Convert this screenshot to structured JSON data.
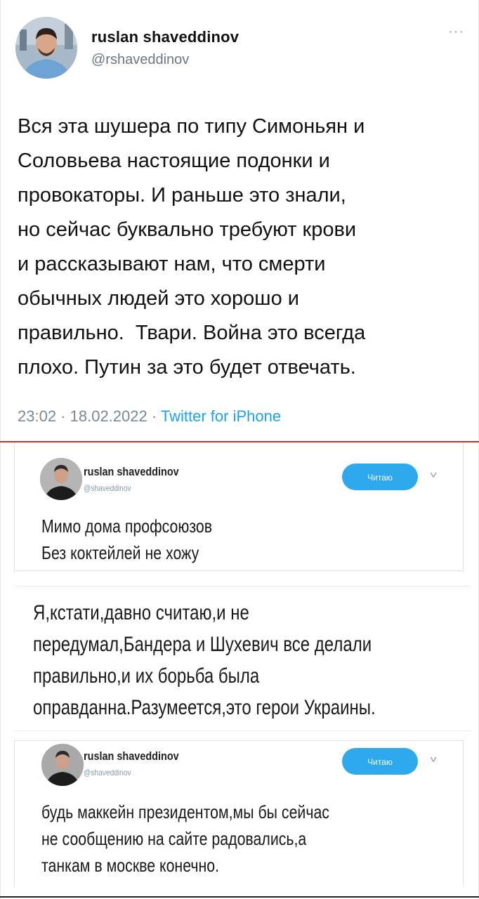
{
  "main_tweet": {
    "name": "ruslan shaveddinov",
    "handle": "@rshaveddinov",
    "more": "···",
    "text_lines": [
      "Вся эта шушера по типу Симоньян и",
      "Соловьева настоящие подонки и",
      "провокаторы. И раньше это знали,",
      "но сейчас буквально требуют крови",
      "и рассказывают нам, что смерти",
      "обычных людей это хорошо и",
      "правильно.  Твари. Война это всегда",
      "плохо. Путин за это будет отвечать."
    ],
    "time": "23:02",
    "date": "18.02.2022",
    "source": "Twitter for iPhone",
    "separator": " · "
  },
  "screenshot_1": {
    "name": "ruslan shaveddinov",
    "handle": "@shaveddinov",
    "follow_label": "Читаю",
    "chevron": "˅",
    "text_lines": [
      "Мимо дома профсоюзов",
      "Без коктейлей не хожу"
    ]
  },
  "screenshot_2": {
    "text_lines": [
      "Я,кстати,давно считаю,и не",
      "передумал,Бандера и Шухевич все делали",
      "правильно,и их борьба была",
      "оправданна.Разумеется,это герои Украины."
    ]
  },
  "screenshot_3": {
    "name": "ruslan shaveddinov",
    "handle": "@shaveddinov",
    "follow_label": "Читаю",
    "chevron": "˅",
    "text_lines": [
      "будь маккейн президентом,мы бы сейчас",
      "не сообщению на сайте радовались,а",
      "танкам в москве конечно."
    ]
  },
  "colors": {
    "accent": "#1da1f2",
    "follow_button": "#2fa9ee",
    "divider": "#c8302c"
  }
}
